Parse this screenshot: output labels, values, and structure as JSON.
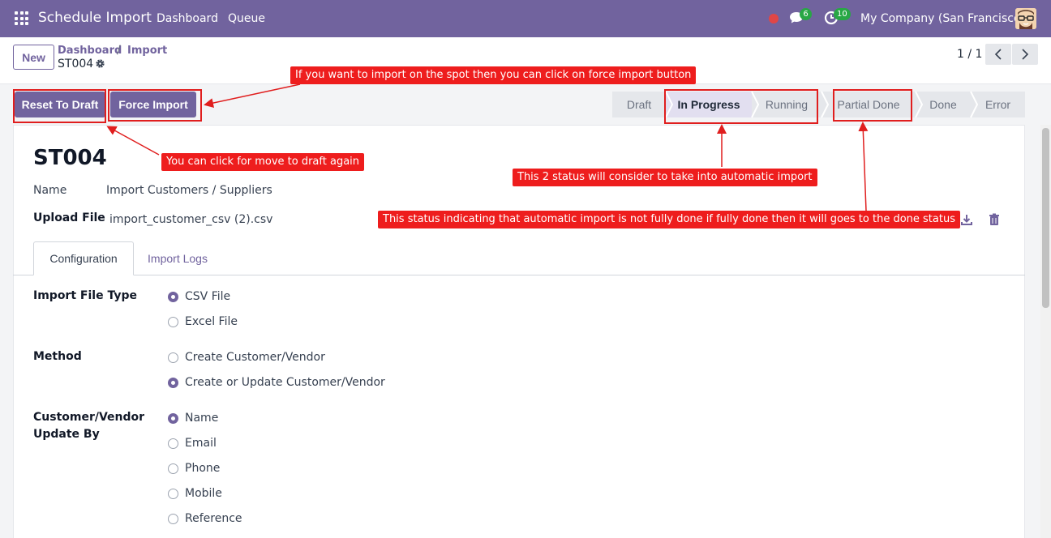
{
  "navbar": {
    "app_title": "Schedule Import",
    "links": [
      "Dashboard",
      "Queue"
    ],
    "chat_badge": "6",
    "activity_badge": "10",
    "company": "My Company (San Francisco)"
  },
  "control": {
    "new_label": "New",
    "breadcrumb": [
      "Dashboard",
      "Import"
    ],
    "breadcrumb_sep": "/",
    "record": "ST004",
    "pager": "1 / 1"
  },
  "actions": {
    "reset_label": "Reset To Draft",
    "force_label": "Force Import"
  },
  "stages": [
    "Draft",
    "In Progress",
    "Running",
    "Partial Done",
    "Done",
    "Error"
  ],
  "active_stage": "In Progress",
  "form": {
    "title": "ST004",
    "name_label": "Name",
    "name_value": "Import Customers / Suppliers",
    "upload_label": "Upload File",
    "upload_value": "import_customer_csv (2).csv",
    "tabs": [
      "Configuration",
      "Import Logs"
    ],
    "file_type_label": "Import File Type",
    "file_type_options": [
      "CSV File",
      "Excel File"
    ],
    "file_type_selected": "CSV File",
    "method_label": "Method",
    "method_options": [
      "Create Customer/Vendor",
      "Create or Update Customer/Vendor"
    ],
    "method_selected": "Create or Update Customer/Vendor",
    "update_by_label_1": "Customer/Vendor",
    "update_by_label_2": "Update By",
    "update_by_options": [
      "Name",
      "Email",
      "Phone",
      "Mobile",
      "Reference"
    ],
    "update_by_selected": "Name"
  },
  "annotations": {
    "force": "If you want to import on the spot then you can click on force import button",
    "reset": "You can click for move to draft again",
    "status2": "This 2 status will consider to take into automatic import",
    "partial": "This status indicating that automatic import is not fully done if fully done then it will goes to the done status"
  },
  "colors": {
    "brand": "#71639e",
    "annotation": "#ee1d1d",
    "badge": "#28a745"
  }
}
